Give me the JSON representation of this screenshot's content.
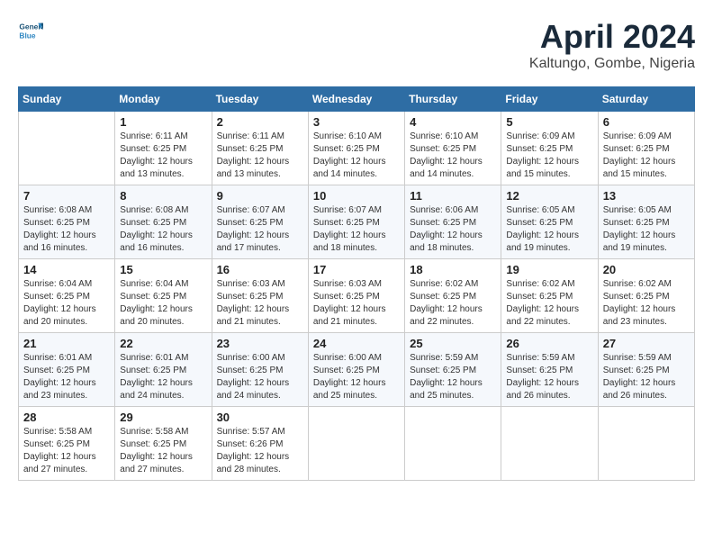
{
  "header": {
    "logo_line1": "General",
    "logo_line2": "Blue",
    "title": "April 2024",
    "subtitle": "Kaltungo, Gombe, Nigeria"
  },
  "weekdays": [
    "Sunday",
    "Monday",
    "Tuesday",
    "Wednesday",
    "Thursday",
    "Friday",
    "Saturday"
  ],
  "weeks": [
    [
      {
        "day": "",
        "info": ""
      },
      {
        "day": "1",
        "info": "Sunrise: 6:11 AM\nSunset: 6:25 PM\nDaylight: 12 hours\nand 13 minutes."
      },
      {
        "day": "2",
        "info": "Sunrise: 6:11 AM\nSunset: 6:25 PM\nDaylight: 12 hours\nand 13 minutes."
      },
      {
        "day": "3",
        "info": "Sunrise: 6:10 AM\nSunset: 6:25 PM\nDaylight: 12 hours\nand 14 minutes."
      },
      {
        "day": "4",
        "info": "Sunrise: 6:10 AM\nSunset: 6:25 PM\nDaylight: 12 hours\nand 14 minutes."
      },
      {
        "day": "5",
        "info": "Sunrise: 6:09 AM\nSunset: 6:25 PM\nDaylight: 12 hours\nand 15 minutes."
      },
      {
        "day": "6",
        "info": "Sunrise: 6:09 AM\nSunset: 6:25 PM\nDaylight: 12 hours\nand 15 minutes."
      }
    ],
    [
      {
        "day": "7",
        "info": "Sunrise: 6:08 AM\nSunset: 6:25 PM\nDaylight: 12 hours\nand 16 minutes."
      },
      {
        "day": "8",
        "info": "Sunrise: 6:08 AM\nSunset: 6:25 PM\nDaylight: 12 hours\nand 16 minutes."
      },
      {
        "day": "9",
        "info": "Sunrise: 6:07 AM\nSunset: 6:25 PM\nDaylight: 12 hours\nand 17 minutes."
      },
      {
        "day": "10",
        "info": "Sunrise: 6:07 AM\nSunset: 6:25 PM\nDaylight: 12 hours\nand 18 minutes."
      },
      {
        "day": "11",
        "info": "Sunrise: 6:06 AM\nSunset: 6:25 PM\nDaylight: 12 hours\nand 18 minutes."
      },
      {
        "day": "12",
        "info": "Sunrise: 6:05 AM\nSunset: 6:25 PM\nDaylight: 12 hours\nand 19 minutes."
      },
      {
        "day": "13",
        "info": "Sunrise: 6:05 AM\nSunset: 6:25 PM\nDaylight: 12 hours\nand 19 minutes."
      }
    ],
    [
      {
        "day": "14",
        "info": "Sunrise: 6:04 AM\nSunset: 6:25 PM\nDaylight: 12 hours\nand 20 minutes."
      },
      {
        "day": "15",
        "info": "Sunrise: 6:04 AM\nSunset: 6:25 PM\nDaylight: 12 hours\nand 20 minutes."
      },
      {
        "day": "16",
        "info": "Sunrise: 6:03 AM\nSunset: 6:25 PM\nDaylight: 12 hours\nand 21 minutes."
      },
      {
        "day": "17",
        "info": "Sunrise: 6:03 AM\nSunset: 6:25 PM\nDaylight: 12 hours\nand 21 minutes."
      },
      {
        "day": "18",
        "info": "Sunrise: 6:02 AM\nSunset: 6:25 PM\nDaylight: 12 hours\nand 22 minutes."
      },
      {
        "day": "19",
        "info": "Sunrise: 6:02 AM\nSunset: 6:25 PM\nDaylight: 12 hours\nand 22 minutes."
      },
      {
        "day": "20",
        "info": "Sunrise: 6:02 AM\nSunset: 6:25 PM\nDaylight: 12 hours\nand 23 minutes."
      }
    ],
    [
      {
        "day": "21",
        "info": "Sunrise: 6:01 AM\nSunset: 6:25 PM\nDaylight: 12 hours\nand 23 minutes."
      },
      {
        "day": "22",
        "info": "Sunrise: 6:01 AM\nSunset: 6:25 PM\nDaylight: 12 hours\nand 24 minutes."
      },
      {
        "day": "23",
        "info": "Sunrise: 6:00 AM\nSunset: 6:25 PM\nDaylight: 12 hours\nand 24 minutes."
      },
      {
        "day": "24",
        "info": "Sunrise: 6:00 AM\nSunset: 6:25 PM\nDaylight: 12 hours\nand 25 minutes."
      },
      {
        "day": "25",
        "info": "Sunrise: 5:59 AM\nSunset: 6:25 PM\nDaylight: 12 hours\nand 25 minutes."
      },
      {
        "day": "26",
        "info": "Sunrise: 5:59 AM\nSunset: 6:25 PM\nDaylight: 12 hours\nand 26 minutes."
      },
      {
        "day": "27",
        "info": "Sunrise: 5:59 AM\nSunset: 6:25 PM\nDaylight: 12 hours\nand 26 minutes."
      }
    ],
    [
      {
        "day": "28",
        "info": "Sunrise: 5:58 AM\nSunset: 6:25 PM\nDaylight: 12 hours\nand 27 minutes."
      },
      {
        "day": "29",
        "info": "Sunrise: 5:58 AM\nSunset: 6:25 PM\nDaylight: 12 hours\nand 27 minutes."
      },
      {
        "day": "30",
        "info": "Sunrise: 5:57 AM\nSunset: 6:26 PM\nDaylight: 12 hours\nand 28 minutes."
      },
      {
        "day": "",
        "info": ""
      },
      {
        "day": "",
        "info": ""
      },
      {
        "day": "",
        "info": ""
      },
      {
        "day": "",
        "info": ""
      }
    ]
  ]
}
